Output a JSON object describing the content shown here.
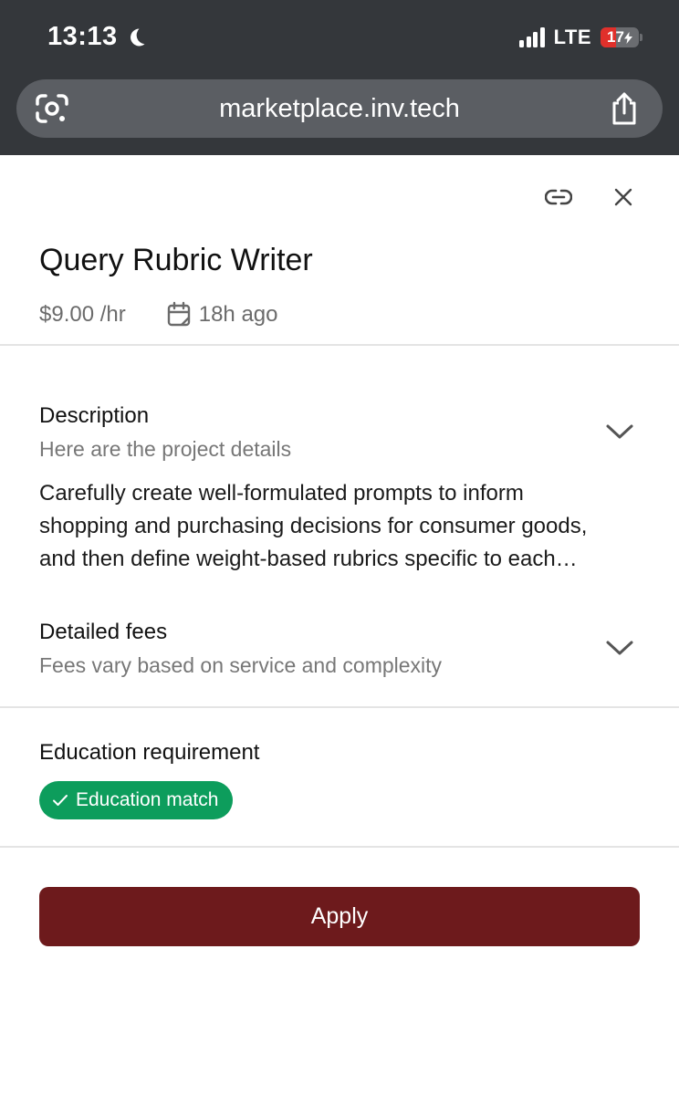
{
  "status_bar": {
    "time": "13:13",
    "network": "LTE",
    "battery_level": "17",
    "icons": [
      "moon-icon",
      "signal-icon",
      "battery-charging-icon"
    ]
  },
  "browser": {
    "url": "marketplace.inv.tech",
    "icons": [
      "google-lens-icon",
      "share-icon"
    ]
  },
  "header": {
    "icons": [
      "link-icon",
      "close-icon"
    ]
  },
  "job": {
    "title": "Query Rubric Writer",
    "rate": "$9.00 /hr",
    "posted": "18h ago"
  },
  "description": {
    "title": "Description",
    "subtitle": "Here are the project details",
    "body_lines": [
      "Carefully create well-formulated prompts to inform",
      "shopping and purchasing decisions for consumer goods,",
      "and then define weight-based rubrics specific to each…"
    ]
  },
  "fees": {
    "title": "Detailed fees",
    "subtitle": "Fees vary based on service and complexity"
  },
  "education": {
    "title": "Education requirement",
    "badge": "Education match"
  },
  "actions": {
    "apply_label": "Apply"
  },
  "colors": {
    "chrome_bg": "#34373b",
    "urlbar_bg": "#5b5e63",
    "badge_green": "#0d9d5c",
    "apply_bg": "#6d1a1c",
    "battery_red": "#e0302b"
  }
}
